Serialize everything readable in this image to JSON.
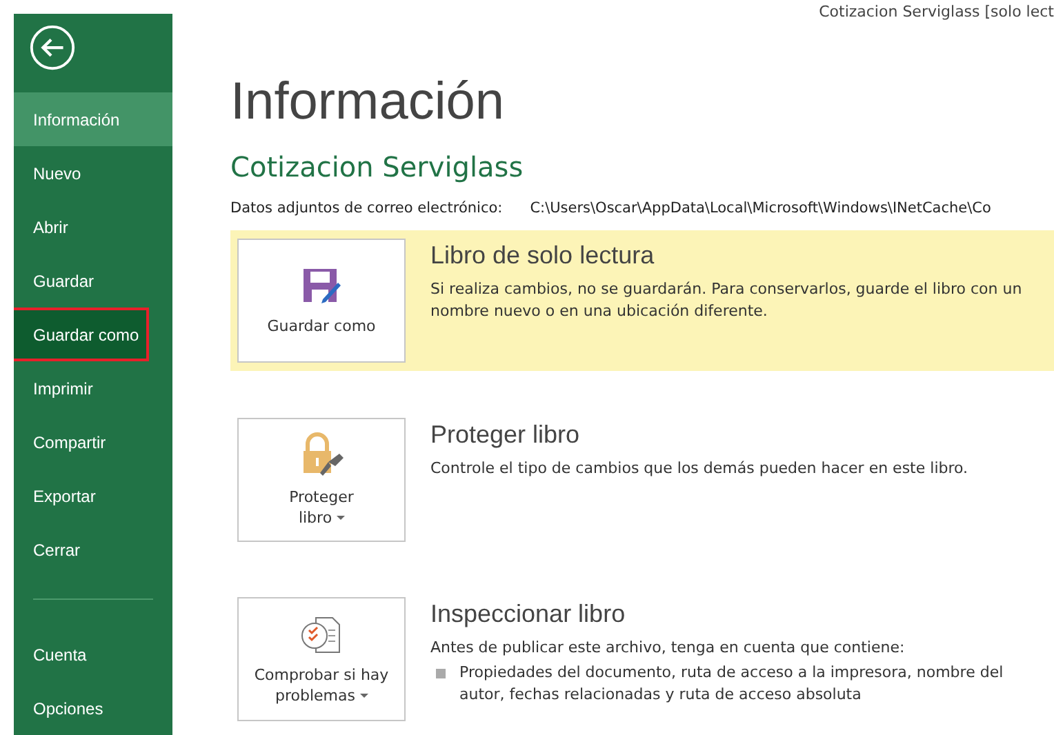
{
  "window": {
    "title": "Cotizacion Serviglass  [solo lect"
  },
  "sidebar": {
    "items": [
      {
        "label": "Información",
        "selected": true,
        "hovered": false,
        "outlined": false
      },
      {
        "label": "Nuevo",
        "selected": false,
        "hovered": false,
        "outlined": false
      },
      {
        "label": "Abrir",
        "selected": false,
        "hovered": false,
        "outlined": false
      },
      {
        "label": "Guardar",
        "selected": false,
        "hovered": false,
        "outlined": false
      },
      {
        "label": "Guardar como",
        "selected": false,
        "hovered": true,
        "outlined": true
      },
      {
        "label": "Imprimir",
        "selected": false,
        "hovered": false,
        "outlined": false
      },
      {
        "label": "Compartir",
        "selected": false,
        "hovered": false,
        "outlined": false
      },
      {
        "label": "Exportar",
        "selected": false,
        "hovered": false,
        "outlined": false
      },
      {
        "label": "Cerrar",
        "selected": false,
        "hovered": false,
        "outlined": false
      }
    ],
    "bottom_items": [
      {
        "label": "Cuenta",
        "selected": false,
        "hovered": false,
        "outlined": false
      },
      {
        "label": "Opciones",
        "selected": false,
        "hovered": false,
        "outlined": false
      }
    ]
  },
  "page": {
    "heading": "Información",
    "document_name": "Cotizacion Serviglass",
    "attachment_label": "Datos adjuntos de correo electrónico:",
    "attachment_path": "C:\\Users\\Oscar\\AppData\\Local\\Microsoft\\Windows\\INetCache\\Co"
  },
  "sections": [
    {
      "kind": "save",
      "warning": true,
      "button": [
        "Guardar como"
      ],
      "dropdown": false,
      "title": "Libro de solo lectura",
      "description": "Si realiza cambios, no se guardarán. Para conservarlos, guarde el libro con un nombre nuevo o en una ubicación diferente."
    },
    {
      "kind": "protect",
      "warning": false,
      "button": [
        "Proteger",
        "libro"
      ],
      "dropdown": true,
      "title": "Proteger libro",
      "description": "Controle el tipo de cambios que los demás pueden hacer en este libro."
    },
    {
      "kind": "inspect",
      "warning": false,
      "button": [
        "Comprobar si hay",
        "problemas"
      ],
      "dropdown": true,
      "title": "Inspeccionar libro",
      "description": "Antes de publicar este archivo, tenga en cuenta que contiene:",
      "bullets": [
        "Propiedades del documento, ruta de acceso a la impresora, nombre del autor, fechas relacionadas y ruta de acceso absoluta"
      ]
    }
  ]
}
